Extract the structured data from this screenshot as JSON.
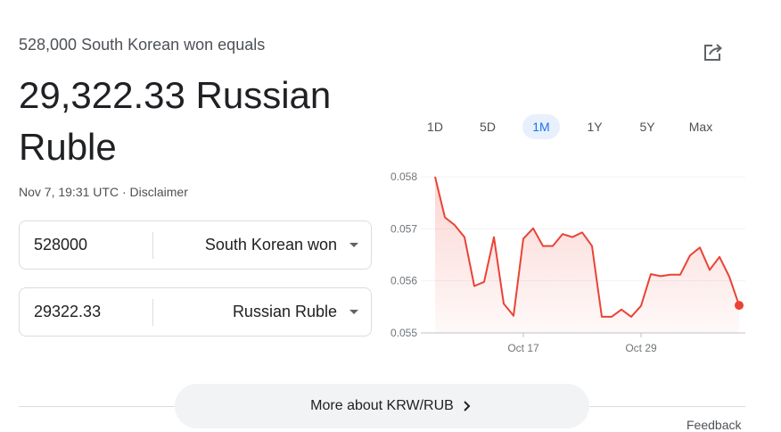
{
  "header": {
    "subtitle": "528,000 South Korean won equals",
    "result": "29,322.33 Russian Ruble",
    "timestamp": "Nov 7, 19:31 UTC",
    "separator": " · ",
    "disclaimer": "Disclaimer",
    "share_icon": "share-icon"
  },
  "converter": {
    "from": {
      "amount": "528000",
      "currency": "South Korean won"
    },
    "to": {
      "amount": "29322.33",
      "currency": "Russian Ruble"
    }
  },
  "chart_tabs": [
    {
      "label": "1D",
      "active": false
    },
    {
      "label": "5D",
      "active": false
    },
    {
      "label": "1M",
      "active": true
    },
    {
      "label": "1Y",
      "active": false
    },
    {
      "label": "5Y",
      "active": false
    },
    {
      "label": "Max",
      "active": false
    }
  ],
  "chart_data": {
    "type": "area",
    "title": "",
    "xlabel": "",
    "ylabel": "",
    "x_tick_labels": [
      "Oct 17",
      "Oct 29"
    ],
    "y_ticks": [
      "0.055",
      "0.056",
      "0.057",
      "0.058"
    ],
    "ylim": [
      0.055,
      0.058
    ],
    "line_color": "#ea4335",
    "values": [
      0.058,
      0.05722,
      0.05707,
      0.05684,
      0.0559,
      0.05598,
      0.05684,
      0.05556,
      0.05533,
      0.05681,
      0.05701,
      0.05667,
      0.05667,
      0.0569,
      0.05684,
      0.05693,
      0.05667,
      0.05531,
      0.05531,
      0.05545,
      0.05531,
      0.05552,
      0.05613,
      0.05609,
      0.05612,
      0.05612,
      0.05649,
      0.05664,
      0.05621,
      0.05646,
      0.05608,
      0.05553
    ],
    "x_tick_indices": [
      9,
      21
    ],
    "grid": true
  },
  "footer": {
    "more_label": "More about KRW/RUB",
    "feedback": "Feedback"
  }
}
